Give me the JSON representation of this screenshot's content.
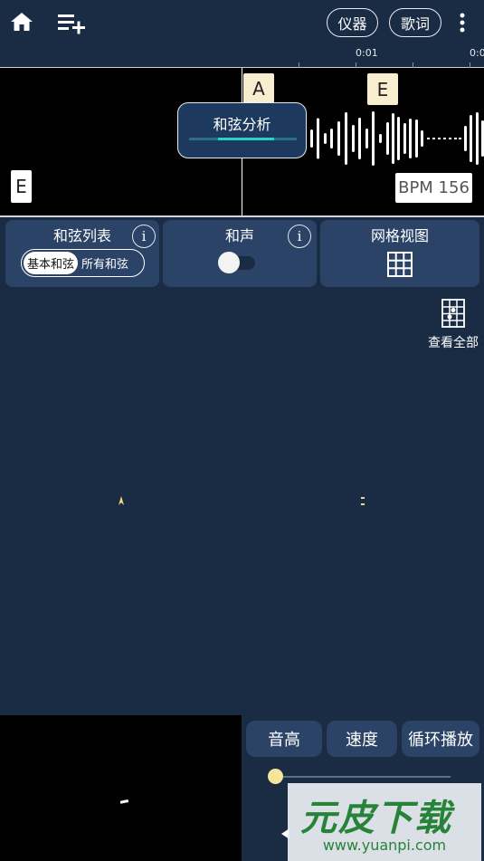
{
  "header": {
    "home_icon": "home-icon",
    "playlist_icon": "playlist-add-icon",
    "instrument_label": "仪器",
    "lyrics_label": "歌词",
    "more_icon": "more-vert-icon"
  },
  "timeline": {
    "ticks": [
      "0:01",
      "0:0"
    ]
  },
  "track": {
    "chord_a": "A",
    "chord_e_top": "E",
    "chord_e_left": "E",
    "analysis_label": "和弦分析",
    "bpm": "BPM 156"
  },
  "panels": {
    "chord_list": {
      "title": "和弦列表",
      "info": "i",
      "options": [
        "基本和弦",
        "所有和弦"
      ],
      "selected": "基本和弦"
    },
    "harmony": {
      "title": "和声",
      "info": "i",
      "toggle_on": false
    },
    "grid_view": {
      "title": "网格视图"
    }
  },
  "view_all_label": "查看全部",
  "controls": {
    "pitch_label": "音高",
    "speed_label": "速度",
    "loop_label": "循环播放"
  },
  "watermark": {
    "title": "元皮下载",
    "url": "www.yuanpi.com"
  },
  "colors": {
    "background": "#1a2b44",
    "panel": "#2b4366",
    "accent_teal": "#27d4c4",
    "chord_tag": "#f7eed0",
    "slider_knob": "#f6e49a"
  }
}
